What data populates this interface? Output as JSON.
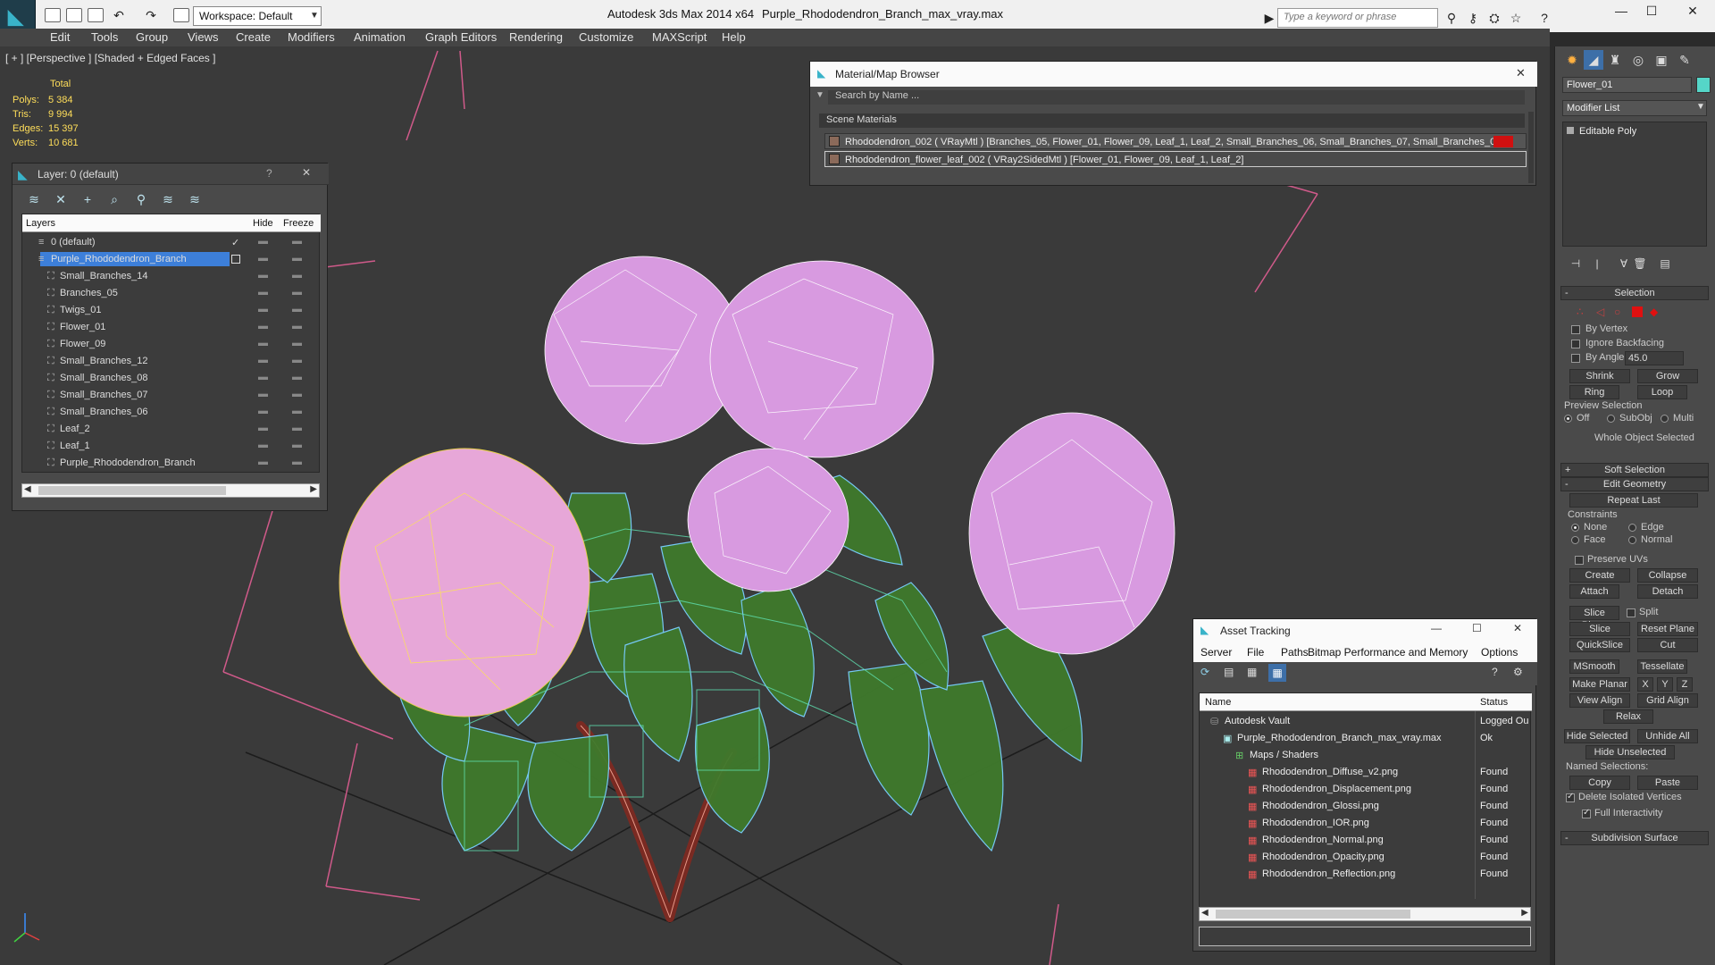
{
  "app": {
    "title": "Autodesk 3ds Max  2014 x64",
    "file": "Purple_Rhododendron_Branch_max_vray.max",
    "workspace": "Workspace: Default",
    "search_placeholder": "Type a keyword or phrase"
  },
  "menu": [
    "Edit",
    "Tools",
    "Group",
    "Views",
    "Create",
    "Modifiers",
    "Animation",
    "Graph Editors",
    "Rendering",
    "Customize",
    "MAXScript",
    "Help"
  ],
  "viewport": {
    "label": "[ + ] [Perspective ] [Shaded + Edged Faces ]",
    "stats_total": "Total",
    "stats": [
      {
        "k": "Polys:",
        "v": "5 384"
      },
      {
        "k": "Tris:",
        "v": "9 994"
      },
      {
        "k": "Edges:",
        "v": "15 397"
      },
      {
        "k": "Verts:",
        "v": "10 681"
      }
    ]
  },
  "layer_panel": {
    "title": "Layer: 0 (default)",
    "help": "?",
    "close": "✕",
    "headers": {
      "layers": "Layers",
      "hide": "Hide",
      "freeze": "Freeze"
    },
    "rows": [
      {
        "name": "0 (default)",
        "level": 1,
        "selected": false,
        "current": true
      },
      {
        "name": "Purple_Rhododendron_Branch",
        "level": 1,
        "selected": true,
        "current": false
      },
      {
        "name": "Small_Branches_14",
        "level": 2
      },
      {
        "name": "Branches_05",
        "level": 2
      },
      {
        "name": "Twigs_01",
        "level": 2
      },
      {
        "name": "Flower_01",
        "level": 2
      },
      {
        "name": "Flower_09",
        "level": 2
      },
      {
        "name": "Small_Branches_12",
        "level": 2
      },
      {
        "name": "Small_Branches_08",
        "level": 2
      },
      {
        "name": "Small_Branches_07",
        "level": 2
      },
      {
        "name": "Small_Branches_06",
        "level": 2
      },
      {
        "name": "Leaf_2",
        "level": 2
      },
      {
        "name": "Leaf_1",
        "level": 2
      },
      {
        "name": "Purple_Rhododendron_Branch",
        "level": 2
      }
    ]
  },
  "material_browser": {
    "title": "Material/Map Browser",
    "search": "Search by Name ...",
    "section": "Scene Materials",
    "rows": [
      "Rhododendron_002  ( VRayMtl )  [Branches_05, Flower_01, Flower_09, Leaf_1, Leaf_2, Small_Branches_06, Small_Branches_07, Small_Branches_0...",
      "Rhododendron_flower_leaf_002  ( VRay2SidedMtl )  [Flower_01, Flower_09, Leaf_1, Leaf_2]"
    ]
  },
  "asset_tracking": {
    "title": "Asset Tracking",
    "menu": [
      "Server",
      "File",
      "Paths",
      "Bitmap Performance and Memory",
      "Options"
    ],
    "headers": {
      "name": "Name",
      "status": "Status"
    },
    "rows": [
      {
        "name": "Autodesk Vault",
        "status": "Logged Ou",
        "level": 1
      },
      {
        "name": "Purple_Rhododendron_Branch_max_vray.max",
        "status": "Ok",
        "level": 2
      },
      {
        "name": "Maps / Shaders",
        "status": "",
        "level": 3
      },
      {
        "name": "Rhododendron_Diffuse_v2.png",
        "status": "Found",
        "level": 4
      },
      {
        "name": "Rhododendron_Displacement.png",
        "status": "Found",
        "level": 4
      },
      {
        "name": "Rhododendron_Glossi.png",
        "status": "Found",
        "level": 4
      },
      {
        "name": "Rhododendron_IOR.png",
        "status": "Found",
        "level": 4
      },
      {
        "name": "Rhododendron_Normal.png",
        "status": "Found",
        "level": 4
      },
      {
        "name": "Rhododendron_Opacity.png",
        "status": "Found",
        "level": 4
      },
      {
        "name": "Rhododendron_Reflection.png",
        "status": "Found",
        "level": 4
      }
    ]
  },
  "command_panel": {
    "object_name": "Flower_01",
    "modifier_list": "Modifier List",
    "stack_item": "Editable Poly",
    "selection": "Selection",
    "by_vertex": "By Vertex",
    "ignore_backfacing": "Ignore Backfacing",
    "by_angle": "By Angle:",
    "angle_value": "45.0",
    "shrink": "Shrink",
    "grow": "Grow",
    "ring": "Ring",
    "loop": "Loop",
    "preview_selection": "Preview Selection",
    "off": "Off",
    "subobj": "SubObj",
    "multi": "Multi",
    "whole_object": "Whole Object Selected",
    "soft_selection": "Soft Selection",
    "edit_geometry": "Edit Geometry",
    "repeat_last": "Repeat Last",
    "constraints": "Constraints",
    "none": "None",
    "edge": "Edge",
    "face": "Face",
    "normal": "Normal",
    "preserve_uvs": "Preserve UVs",
    "create": "Create",
    "collapse": "Collapse",
    "attach": "Attach",
    "detach": "Detach",
    "slice_plane": "Slice Plane",
    "split": "Split",
    "slice": "Slice",
    "reset_plane": "Reset Plane",
    "quickslice": "QuickSlice",
    "cut": "Cut",
    "msmooth": "MSmooth",
    "tessellate": "Tessellate",
    "make_planar": "Make Planar",
    "x": "X",
    "y": "Y",
    "z": "Z",
    "view_align": "View Align",
    "grid_align": "Grid Align",
    "relax": "Relax",
    "hide_selected": "Hide Selected",
    "unhide_all": "Unhide All",
    "hide_unselected": "Hide Unselected",
    "named_selections": "Named Selections:",
    "copy": "Copy",
    "paste": "Paste",
    "delete_isolated": "Delete Isolated Vertices",
    "full_interactivity": "Full Interactivity",
    "subdivision_surface": "Subdivision Surface",
    "plus": "+",
    "minus": "-"
  }
}
